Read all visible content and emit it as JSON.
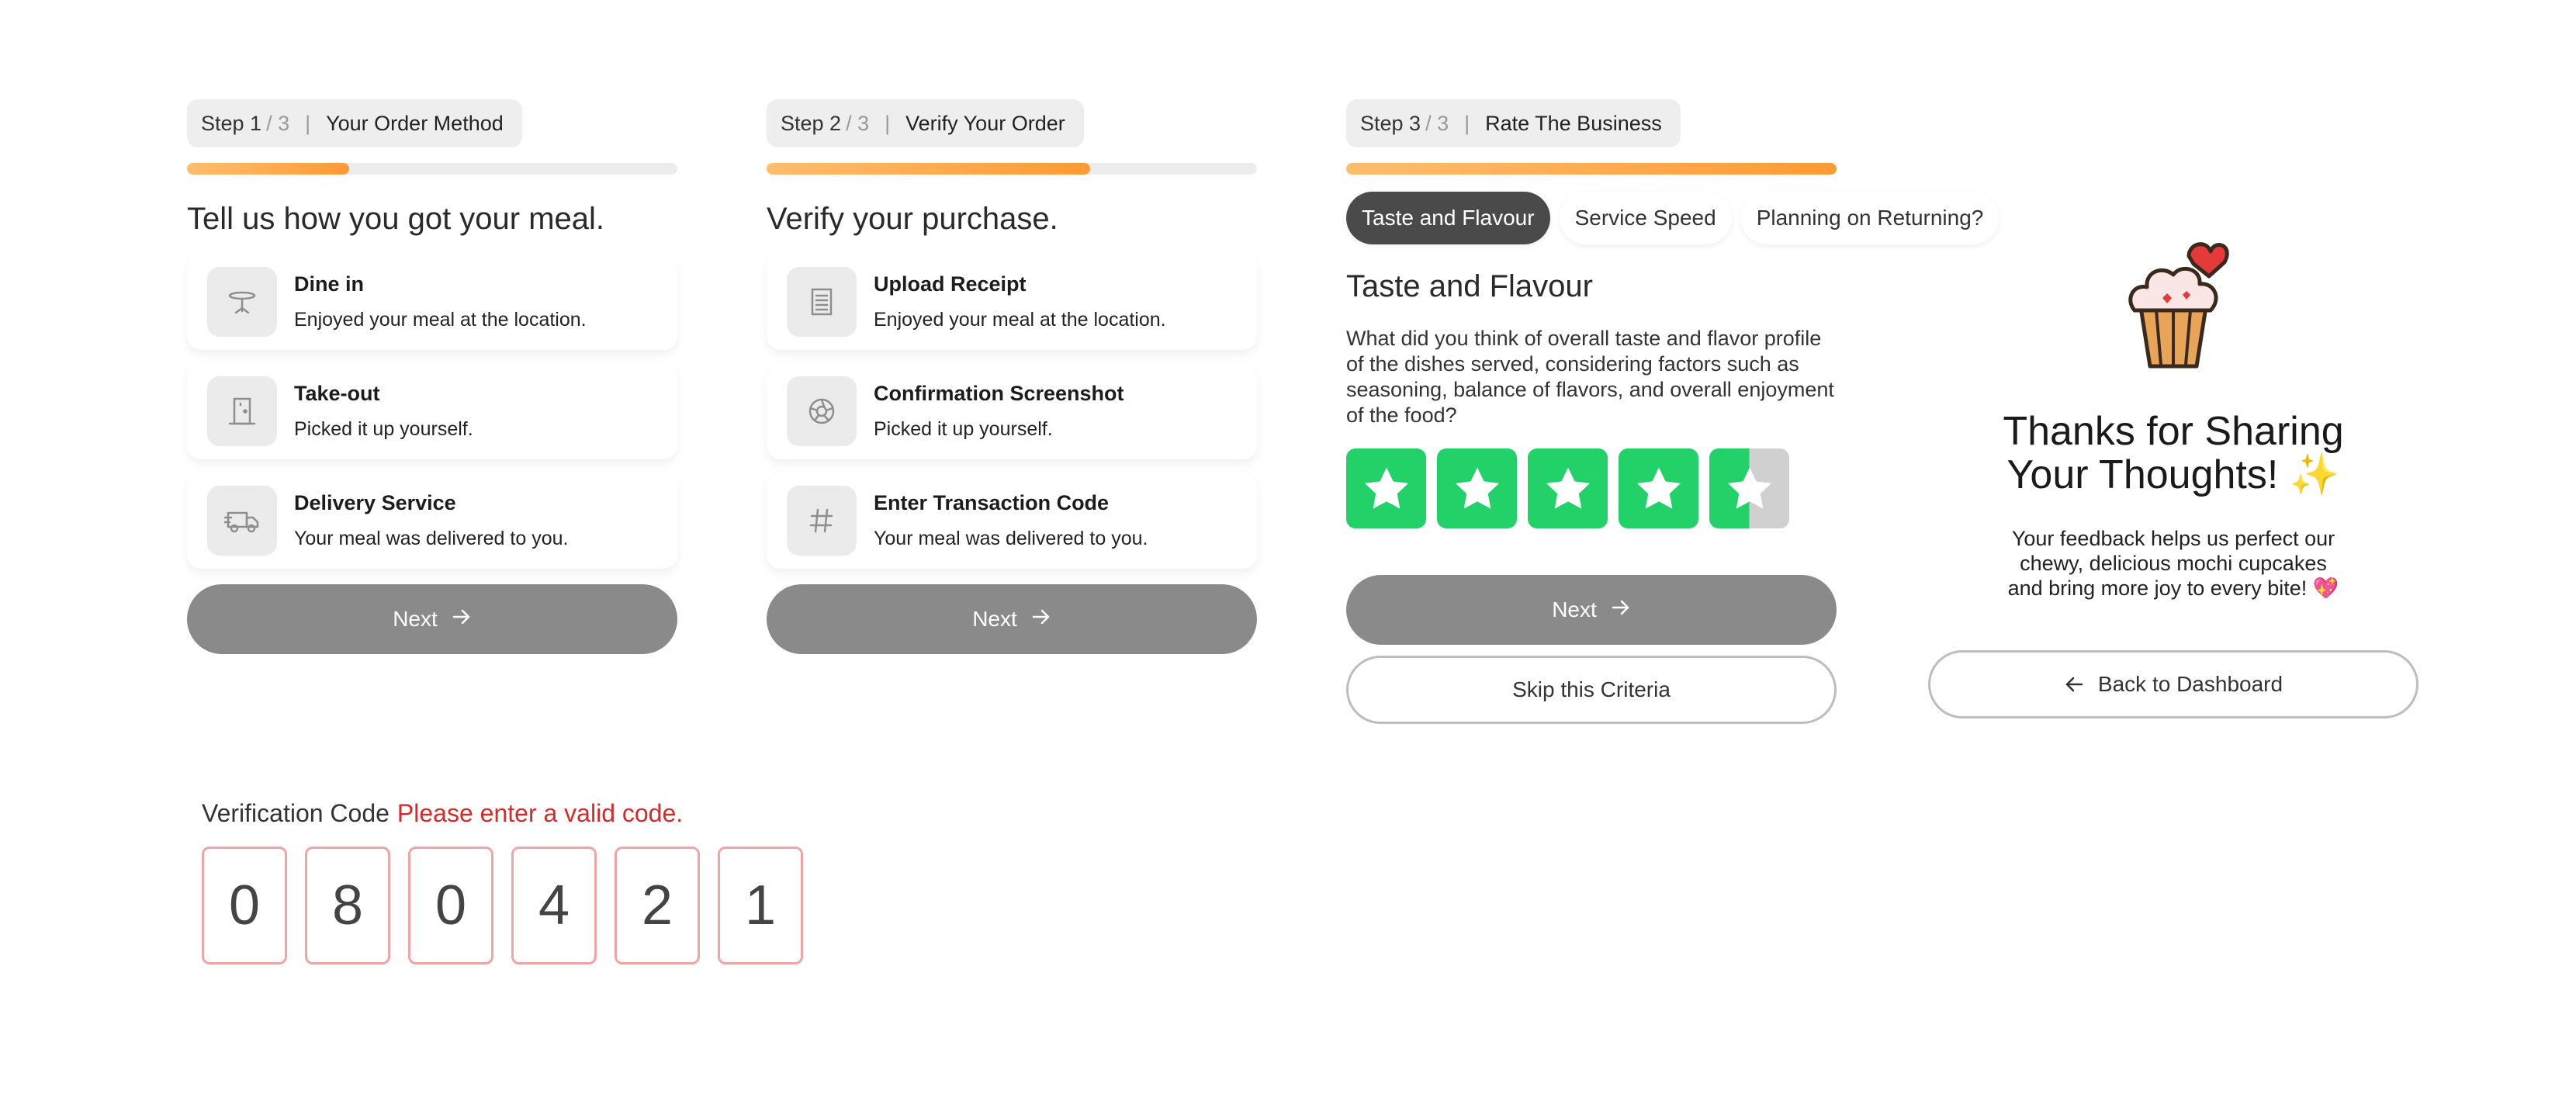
{
  "step1": {
    "step_num": "Step 1",
    "step_total": "/ 3",
    "title": "Your Order Method",
    "progress": 0.33,
    "heading": "Tell us how you got your meal.",
    "options": [
      {
        "title": "Dine in",
        "sub": "Enjoyed your meal at the location.",
        "icon": "table-icon"
      },
      {
        "title": "Take-out",
        "sub": "Picked it up yourself.",
        "icon": "door-icon"
      },
      {
        "title": "Delivery Service",
        "sub": "Your meal was delivered to you.",
        "icon": "truck-icon"
      }
    ],
    "next_label": "Next"
  },
  "step2": {
    "step_num": "Step 2",
    "step_total": "/ 3",
    "title": "Verify Your Order",
    "progress": 0.66,
    "heading": "Verify your purchase.",
    "options": [
      {
        "title": "Upload Receipt",
        "sub": "Enjoyed your meal at the location.",
        "icon": "receipt-icon"
      },
      {
        "title": "Confirmation Screenshot",
        "sub": "Picked it up yourself.",
        "icon": "aperture-icon"
      },
      {
        "title": "Enter Transaction Code",
        "sub": "Your meal was delivered to you.",
        "icon": "hash-icon"
      }
    ],
    "next_label": "Next"
  },
  "step3": {
    "step_num": "Step 3",
    "step_total": "/ 3",
    "title": "Rate The Business",
    "progress": 1.0,
    "tabs": [
      "Taste and Flavour",
      "Service Speed",
      "Planning on Returning?"
    ],
    "active_tab": 0,
    "criteria_title": "Taste and Flavour",
    "criteria_desc": "What did you think of overall taste and flavor profile of the dishes served, considering factors such as seasoning, balance of flavors, and overall enjoyment of the food?",
    "rating": 4.5,
    "rating_max": 5,
    "next_label": "Next",
    "skip_label": "Skip this Criteria"
  },
  "thanks": {
    "title_line1": "Thanks for Sharing",
    "title_line2": "Your Thoughts! ✨",
    "body": "Your feedback helps us perfect our chewy, delicious mochi cupcakes and bring more joy to every bite! 💖",
    "back_label": "Back to Dashboard"
  },
  "verification": {
    "label": "Verification Code",
    "error": "Please enter a valid code.",
    "digits": [
      "0",
      "8",
      "0",
      "4",
      "2",
      "1"
    ]
  },
  "colors": {
    "accent_orange": "#ff9a35",
    "star_green": "#22d269",
    "error_red": "#d62a2a",
    "button_gray": "#8a8a8a"
  }
}
